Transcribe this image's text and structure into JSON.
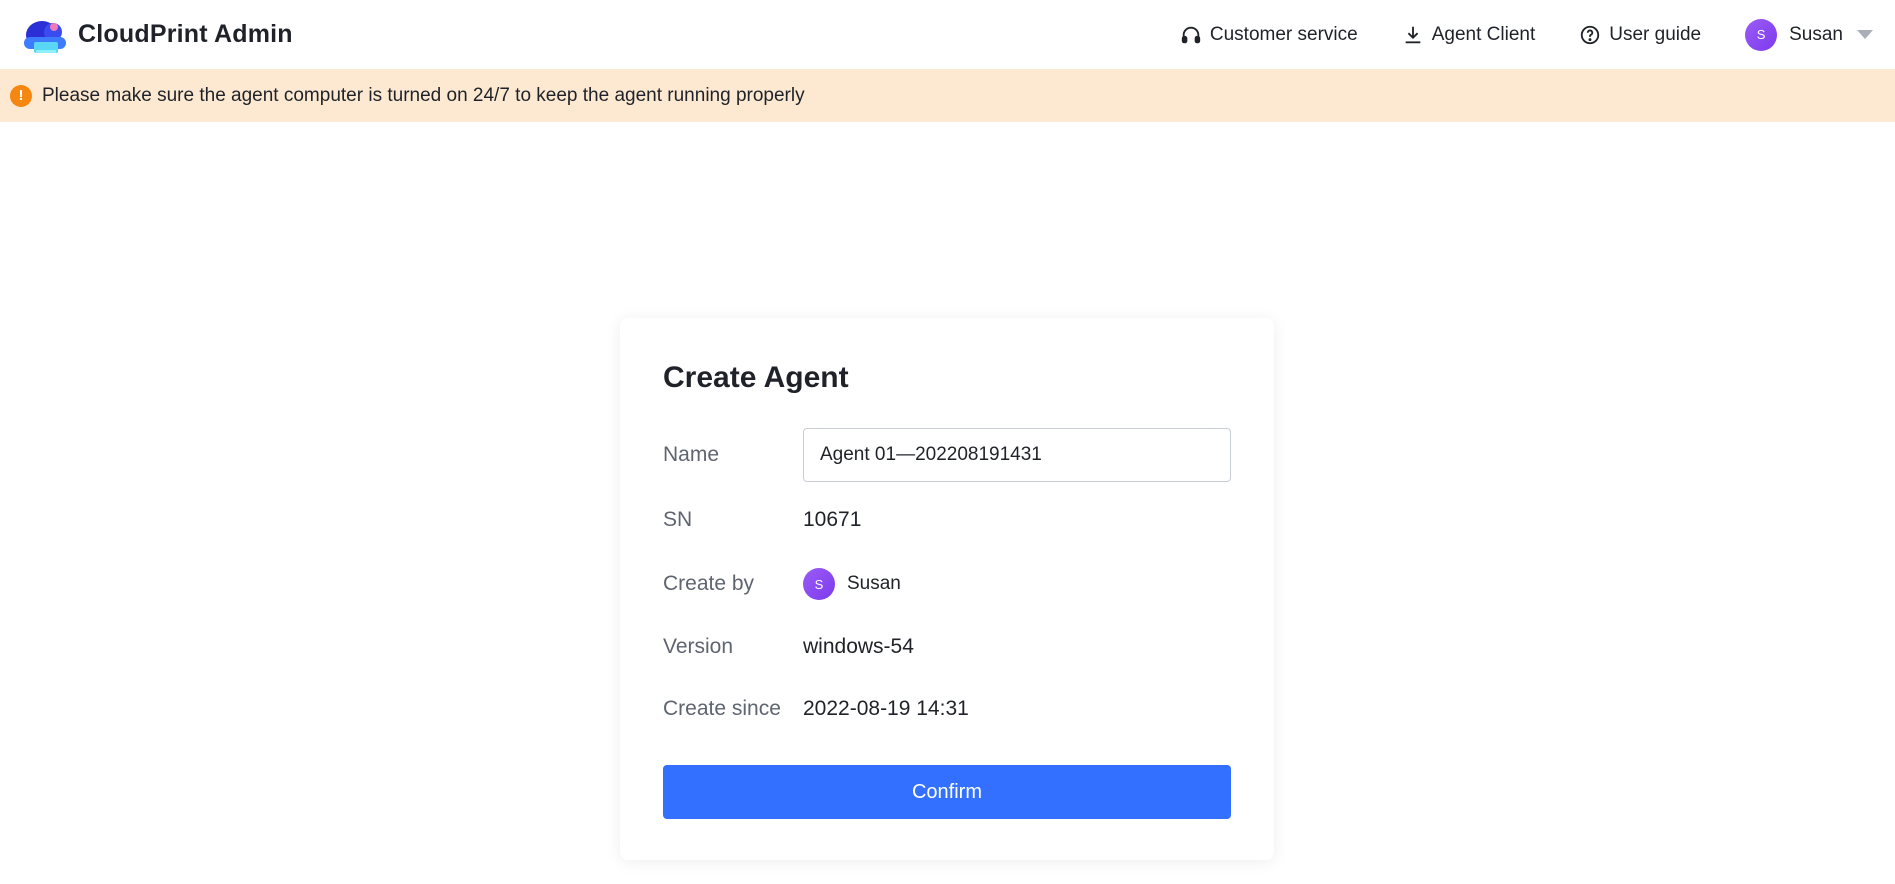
{
  "app": {
    "title": "CloudPrint Admin"
  },
  "header": {
    "customer_service": "Customer service",
    "agent_client": "Agent Client",
    "user_guide": "User guide",
    "user": {
      "initial": "S",
      "name": "Susan"
    }
  },
  "banner": {
    "message": "Please make sure the agent computer is turned on 24/7 to keep the agent running properly"
  },
  "form": {
    "title": "Create Agent",
    "name_label": "Name",
    "name_value": "Agent 01—202208191431",
    "sn_label": "SN",
    "sn_value": "10671",
    "created_by_label": "Create by",
    "created_by": {
      "initial": "S",
      "name": "Susan"
    },
    "version_label": "Version",
    "version_value": "windows-54",
    "create_since_label": "Create since",
    "create_since_value": "2022-08-19 14:31",
    "confirm_label": "Confirm"
  },
  "colors": {
    "primary": "#3370ff",
    "banner_bg": "#fde9d2",
    "warning": "#f5860f",
    "avatar": "#8b5cf6"
  },
  "icons": {
    "logo": "cloud-printer-logo",
    "customer_service": "headset-icon",
    "agent_client": "download-icon",
    "user_guide": "question-circle-icon",
    "warning": "exclamation-circle-icon",
    "dropdown": "caret-down-icon"
  }
}
